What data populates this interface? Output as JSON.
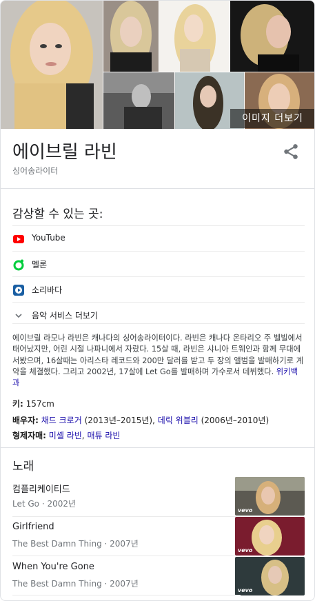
{
  "gallery": {
    "more_images_label": "이미지 더보기"
  },
  "header": {
    "title": "에이브릴 라빈",
    "subtitle": "싱어송라이터"
  },
  "listen": {
    "heading": "감상할 수 있는 곳:",
    "services": [
      {
        "label": "YouTube",
        "icon": "youtube-icon",
        "color": "#ff0000"
      },
      {
        "label": "멜론",
        "icon": "melon-icon",
        "color": "#00cd3c"
      },
      {
        "label": "소리바다",
        "icon": "soribada-icon",
        "color": "#1a5fa3"
      }
    ],
    "more_label": "음악 서비스 더보기"
  },
  "description": {
    "text": "에이브릴 라모나 라빈은 캐나다의 싱어송라이터이다. 라빈은 캐나다 온타리오 주 벨빌에서 태어났지만, 어린 시절 나파니에서 자랐다. 15살 때, 라빈은 샤니아 트웨인과 함께 무대에 서봤으며, 16살때는 아리스타 레코드와 200만 달러를 받고 두 장의 앨범을 발매하기로 계약을 체결했다. 그리고 2002년, 17살에 Let Go를 발매하며 가수로서 데뷔했다.",
    "source_link": "위키백과"
  },
  "facts": {
    "height_label": "키:",
    "height_value": "157cm",
    "spouse_label": "배우자:",
    "spouse1_name": "채드 크로거",
    "spouse1_years": "(2013년–2015년),",
    "spouse2_name": "데릭 위블리",
    "spouse2_years": "(2006년–2010년)",
    "siblings_label": "형제자매:",
    "sibling1": "미셸 라빈",
    "sibling2": "매튜 라빈",
    "sibling_sep": ","
  },
  "songs": {
    "heading": "노래",
    "items": [
      {
        "title": "컴플리케이티드",
        "meta": "Let Go · 2002년",
        "badge": "vevo"
      },
      {
        "title": "Girlfriend",
        "meta": "The Best Damn Thing · 2007년",
        "badge": "vevo"
      },
      {
        "title": "When You're Gone",
        "meta": "The Best Damn Thing · 2007년",
        "badge": "vevo"
      }
    ]
  }
}
